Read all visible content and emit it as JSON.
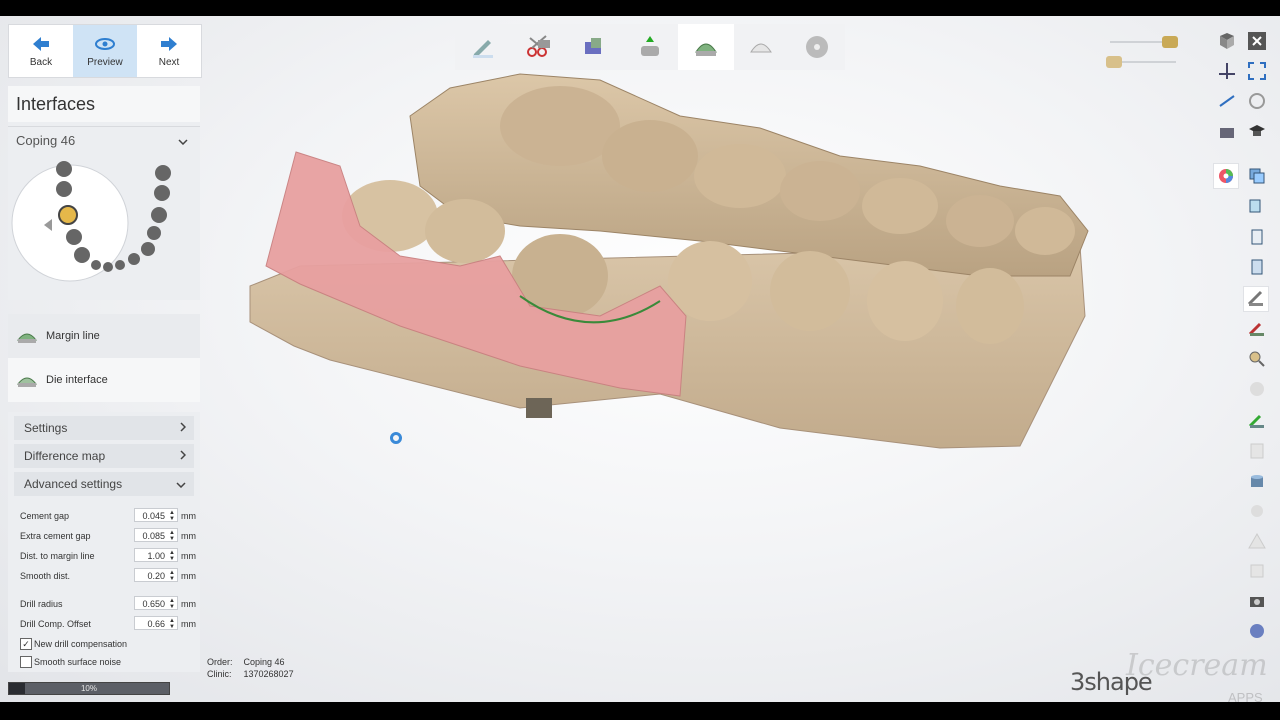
{
  "nav": {
    "back": "Back",
    "preview": "Preview",
    "next": "Next"
  },
  "panel": {
    "title": "Interfaces",
    "coping": "Coping 46"
  },
  "steps": [
    {
      "label": "Margin line"
    },
    {
      "label": "Die interface"
    }
  ],
  "sections": {
    "settings": "Settings",
    "difference_map": "Difference map",
    "advanced": "Advanced settings"
  },
  "advanced_fields": [
    {
      "label": "Cement gap",
      "value": "0.045",
      "unit": "mm"
    },
    {
      "label": "Extra cement gap",
      "value": "0.085",
      "unit": "mm"
    },
    {
      "label": "Dist. to margin line",
      "value": "1.00",
      "unit": "mm"
    },
    {
      "label": "Smooth dist.",
      "value": "0.20",
      "unit": "mm"
    },
    {
      "label": "Drill radius",
      "value": "0.650",
      "unit": "mm"
    },
    {
      "label": "Drill Comp. Offset",
      "value": "0.66",
      "unit": "mm"
    }
  ],
  "checkboxes": [
    {
      "label": "New drill compensation",
      "checked": true
    },
    {
      "label": "Smooth surface noise",
      "checked": false
    }
  ],
  "progress": {
    "percent": 10,
    "label": "10%"
  },
  "info": {
    "order_key": "Order:",
    "order_val": "Coping 46",
    "clinic_key": "Clinic:",
    "clinic_val": "1370268027"
  },
  "branding": {
    "logo": "3shape",
    "watermark": "Icecream",
    "apps": "APPS"
  },
  "colors": {
    "accent": "#3a8ad8",
    "gum": "#e8a0a0",
    "model": "#d8c2a4"
  }
}
